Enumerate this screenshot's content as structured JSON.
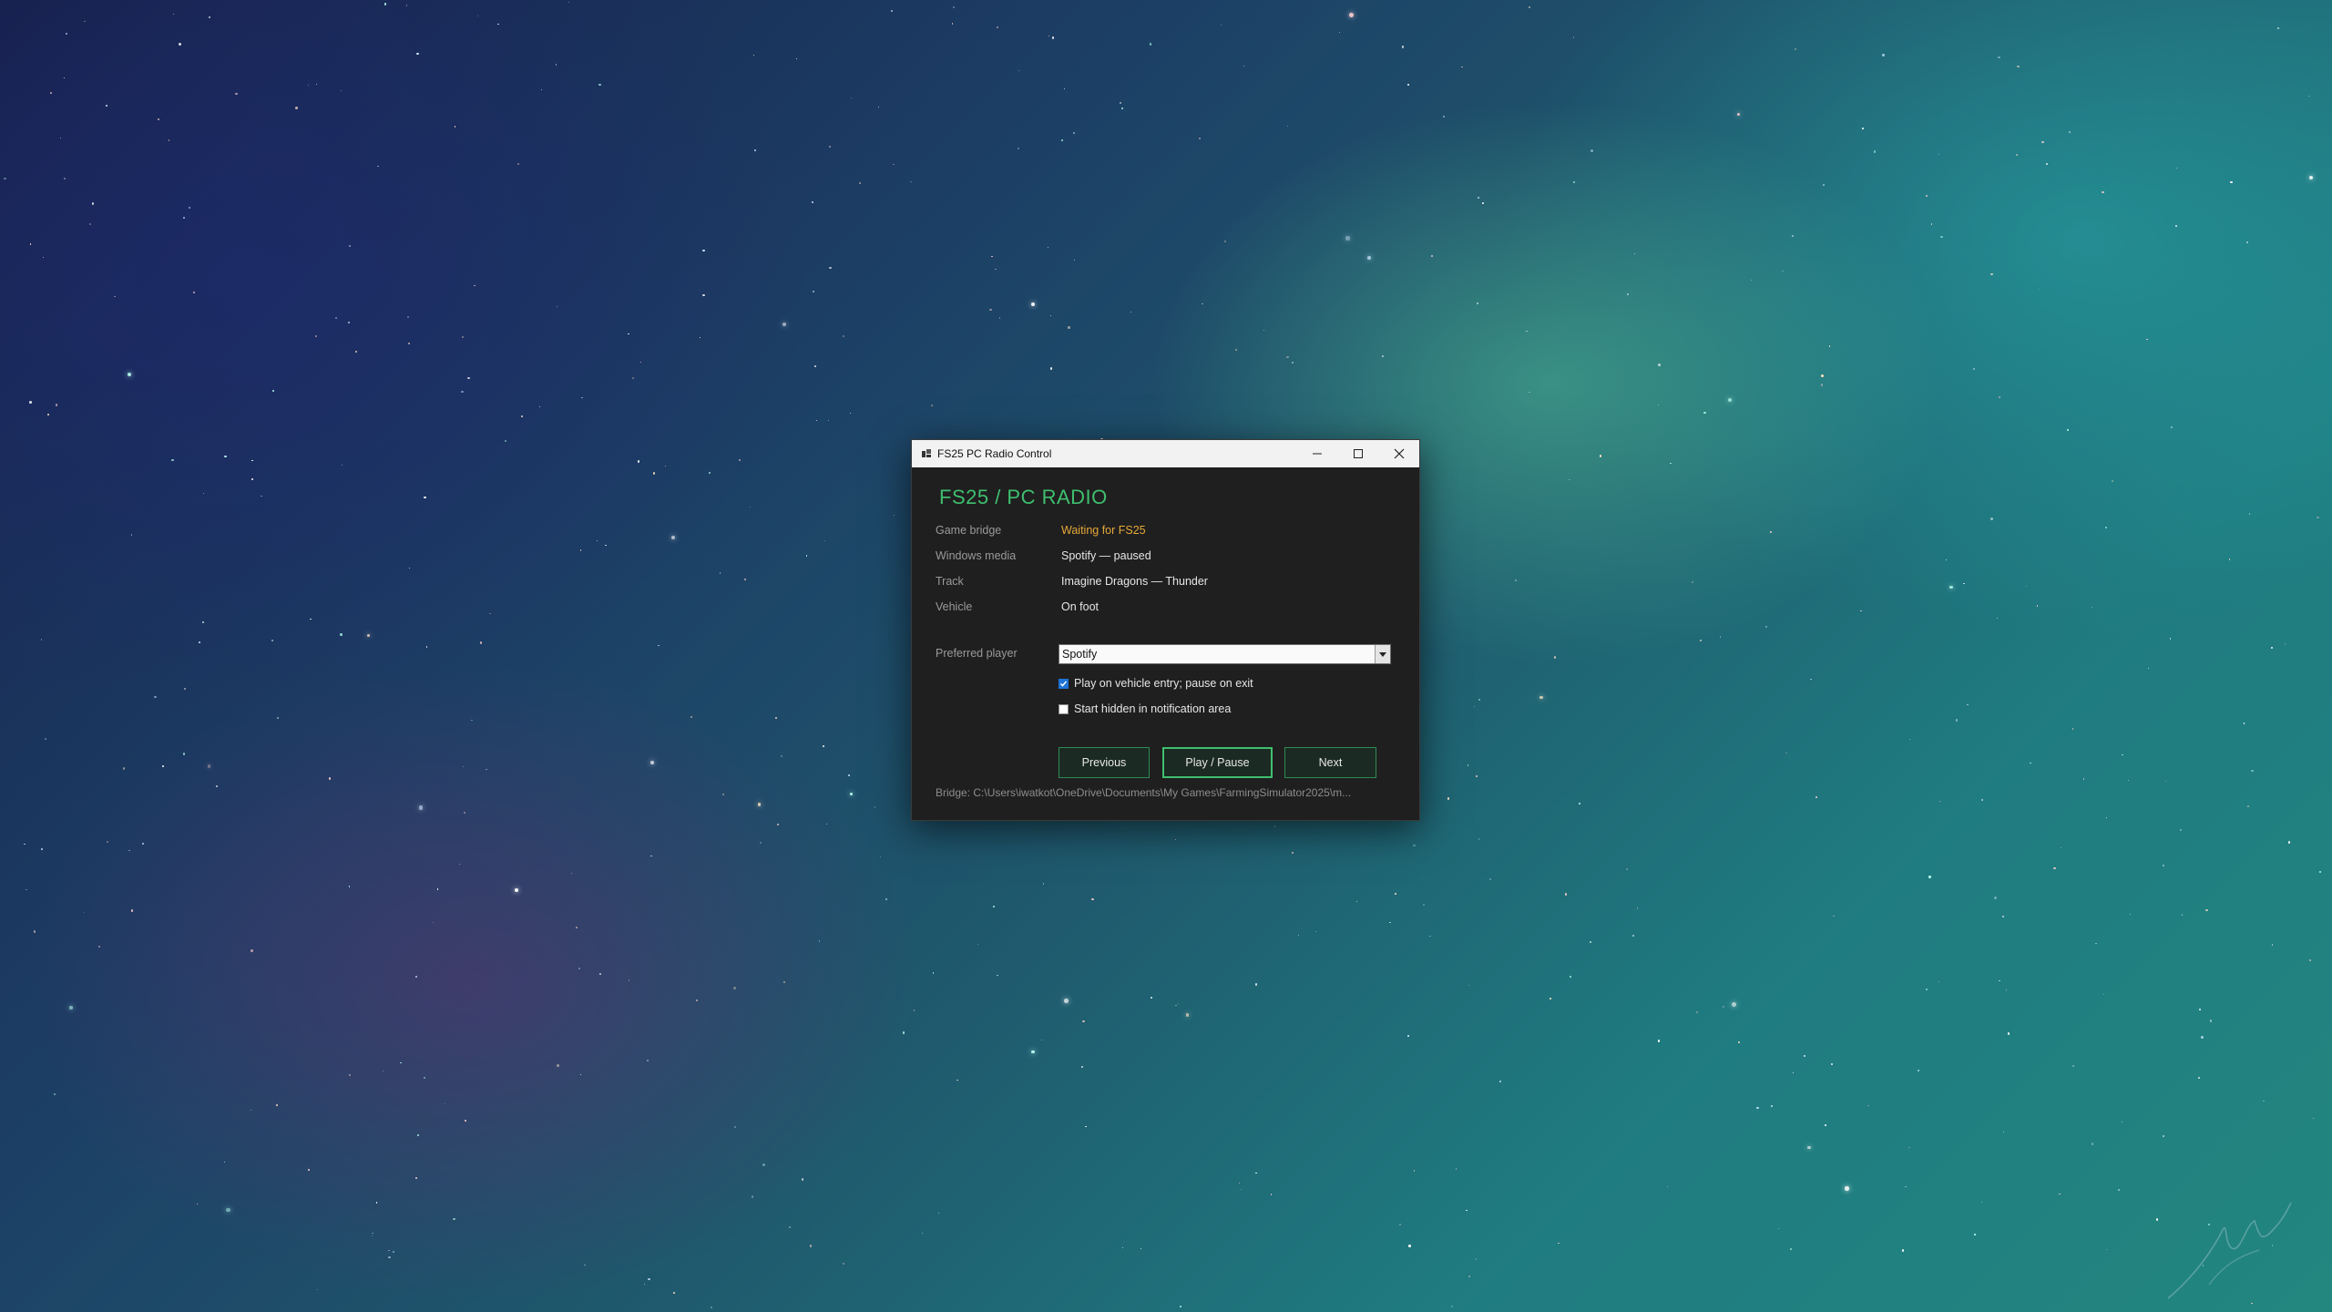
{
  "window": {
    "title": "FS25 PC Radio Control",
    "heading": "FS25  /  PC RADIO"
  },
  "status": {
    "game_bridge_label": "Game bridge",
    "game_bridge_value": "Waiting for FS25",
    "windows_media_label": "Windows media",
    "windows_media_value": "Spotify — paused",
    "track_label": "Track",
    "track_value": "Imagine Dragons — Thunder",
    "vehicle_label": "Vehicle",
    "vehicle_value": "On foot"
  },
  "settings": {
    "preferred_player_label": "Preferred player",
    "preferred_player_value": "Spotify",
    "auto_play_label": "Play on vehicle entry; pause on exit",
    "auto_play_checked": true,
    "start_hidden_label": "Start hidden in notification area",
    "start_hidden_checked": false
  },
  "buttons": {
    "previous": "Previous",
    "play_pause": "Play / Pause",
    "next": "Next"
  },
  "footer": {
    "bridge_path": "Bridge: C:\\Users\\iwatkot\\OneDrive\\Documents\\My Games\\FarmingSimulator2025\\m..."
  },
  "colors": {
    "accent_green": "#3fbf6f",
    "warning_orange": "#e6a93a"
  }
}
